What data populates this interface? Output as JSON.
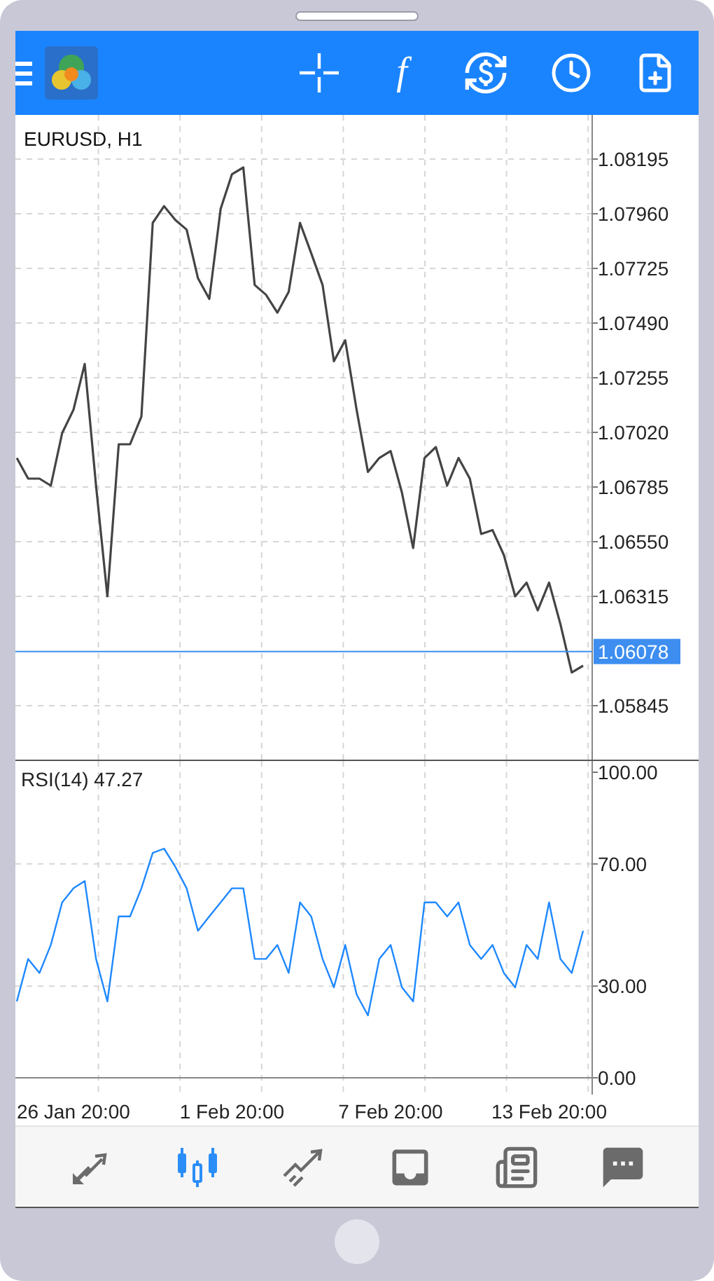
{
  "toolbar": {
    "indicator_button": "f"
  },
  "price_chart": {
    "chart_data": {
      "type": "line",
      "title": "EURUSD, H1",
      "ylim": [
        1.05613,
        1.08385
      ],
      "grid": true,
      "ref_lines": [
        {
          "axis": "y",
          "value": 1.06078,
          "label": "1.06078",
          "color": "#3d8ef0"
        }
      ],
      "yticks": [
        {
          "value": 1.08195,
          "label": "1.08195"
        },
        {
          "value": 1.0796,
          "label": "1.07960"
        },
        {
          "value": 1.07725,
          "label": "1.07725"
        },
        {
          "value": 1.0749,
          "label": "1.07490"
        },
        {
          "value": 1.07255,
          "label": "1.07255"
        },
        {
          "value": 1.0702,
          "label": "1.07020"
        },
        {
          "value": 1.06785,
          "label": "1.06785"
        },
        {
          "value": 1.0655,
          "label": "1.06550"
        },
        {
          "value": 1.06315,
          "label": "1.06315"
        },
        {
          "value": 1.05845,
          "label": "1.05845"
        }
      ],
      "series": [
        {
          "color": "#444444",
          "values": [
            1.0691,
            1.06821,
            1.06821,
            1.06791,
            1.07017,
            1.07118,
            1.07314,
            1.06791,
            1.06315,
            1.06969,
            1.06969,
            1.07088,
            1.07921,
            1.07993,
            1.07933,
            1.07892,
            1.07683,
            1.07594,
            1.07981,
            1.0813,
            1.08159,
            1.07654,
            1.07612,
            1.07535,
            1.07624,
            1.07921,
            1.0779,
            1.07654,
            1.07326,
            1.07416,
            1.07118,
            1.0685,
            1.0691,
            1.0694,
            1.06761,
            1.06523,
            1.0691,
            1.06957,
            1.06791,
            1.0691,
            1.06821,
            1.06583,
            1.066,
            1.06493,
            1.06315,
            1.06374,
            1.06255,
            1.06374,
            1.06196,
            1.05988,
            1.06017
          ]
        }
      ]
    }
  },
  "rsi_chart": {
    "chart_data": {
      "type": "line",
      "title": "RSI(14) 47.27",
      "ylim": [
        0,
        100
      ],
      "grid": true,
      "yticks": [
        {
          "value": 100,
          "label": "100.00"
        },
        {
          "value": 70,
          "label": "70.00"
        },
        {
          "value": 30,
          "label": "30.00"
        },
        {
          "value": 0,
          "label": "0.00"
        }
      ],
      "categories": [
        null,
        null,
        null,
        null,
        null,
        "26 Jan 20:00",
        null,
        null,
        null,
        null,
        null,
        null,
        null,
        null,
        null,
        null,
        null,
        null,
        null,
        "1 Feb 20:00",
        null,
        null,
        null,
        null,
        null,
        null,
        null,
        null,
        null,
        null,
        null,
        null,
        null,
        "7 Feb 20:00",
        null,
        null,
        null,
        null,
        null,
        null,
        null,
        null,
        null,
        null,
        null,
        null,
        null,
        "13 Feb 20:00",
        null,
        null,
        null
      ],
      "series": [
        {
          "color": "#1e88ff",
          "values": [
            25.0,
            38.9,
            34.3,
            43.5,
            57.4,
            62.0,
            64.4,
            38.9,
            25.0,
            52.8,
            52.8,
            62.0,
            73.6,
            75.0,
            69.0,
            62.0,
            48.1,
            52.8,
            57.4,
            62.0,
            62.0,
            38.9,
            38.9,
            43.5,
            34.3,
            57.4,
            52.8,
            38.9,
            29.6,
            43.5,
            27.3,
            20.4,
            38.9,
            43.5,
            29.6,
            25.0,
            57.4,
            57.4,
            52.8,
            57.4,
            43.5,
            38.9,
            43.5,
            34.3,
            29.6,
            43.5,
            38.9,
            57.4,
            38.9,
            34.3,
            48.1
          ]
        }
      ]
    }
  },
  "bottom_nav": [
    {
      "kind": "quotes",
      "selected": false
    },
    {
      "kind": "chart",
      "selected": true
    },
    {
      "kind": "trade",
      "selected": false
    },
    {
      "kind": "history",
      "selected": false
    },
    {
      "kind": "news",
      "selected": false
    },
    {
      "kind": "chat",
      "selected": false
    }
  ]
}
